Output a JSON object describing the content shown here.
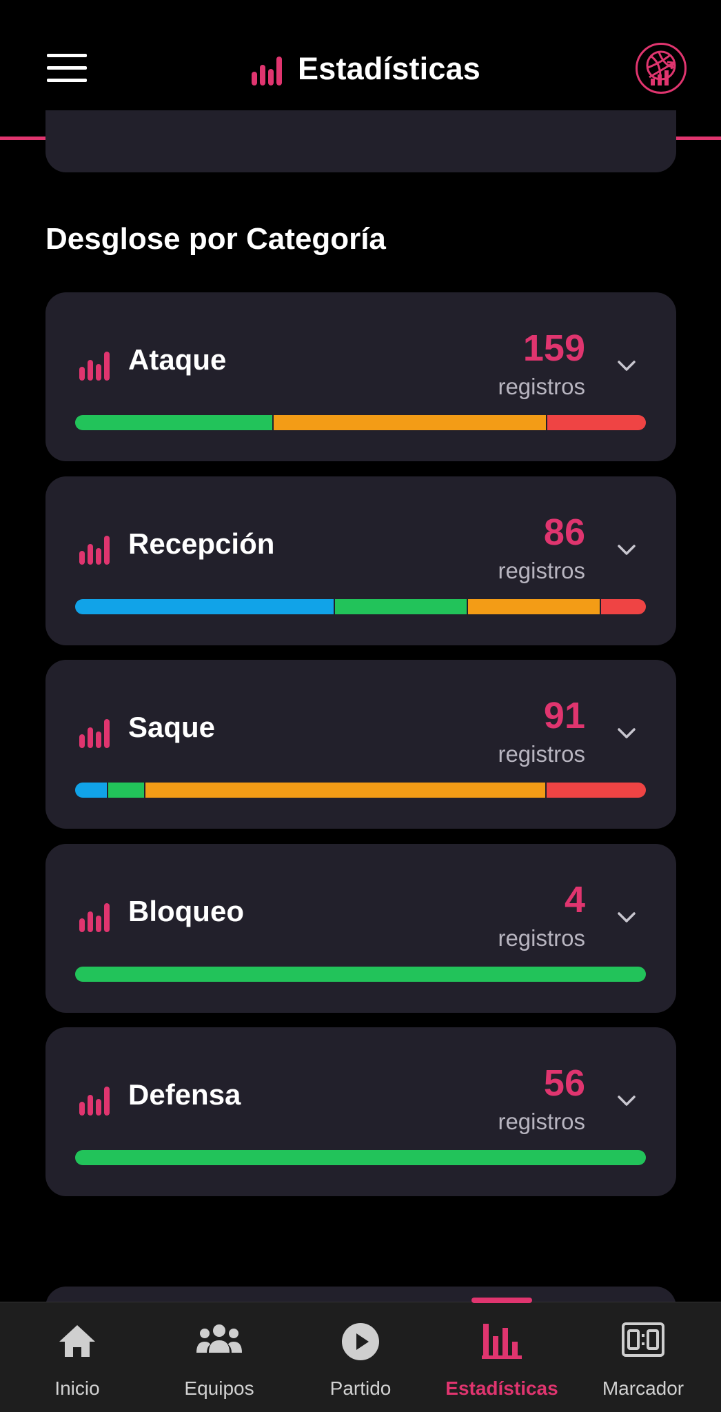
{
  "header": {
    "title": "Estadísticas"
  },
  "section": {
    "title": "Desglose por Categoría"
  },
  "colors": {
    "accent": "#e0356f",
    "blue": "#11a3e8",
    "green": "#22c35a",
    "orange": "#f39c16",
    "red": "#ef4444"
  },
  "categories": [
    {
      "name": "Ataque",
      "count": "159",
      "unit": "registros",
      "distribution": [
        {
          "color": "green",
          "fraction": 0.345
        },
        {
          "color": "orange",
          "fraction": 0.48
        },
        {
          "color": "red",
          "fraction": 0.175
        }
      ]
    },
    {
      "name": "Recepción",
      "count": "86",
      "unit": "registros",
      "distribution": [
        {
          "color": "blue",
          "fraction": 0.453
        },
        {
          "color": "green",
          "fraction": 0.233
        },
        {
          "color": "orange",
          "fraction": 0.233
        },
        {
          "color": "red",
          "fraction": 0.081
        }
      ]
    },
    {
      "name": "Saque",
      "count": "91",
      "unit": "registros",
      "distribution": [
        {
          "color": "blue",
          "fraction": 0.055
        },
        {
          "color": "green",
          "fraction": 0.066
        },
        {
          "color": "orange",
          "fraction": 0.703
        },
        {
          "color": "red",
          "fraction": 0.176
        }
      ]
    },
    {
      "name": "Bloqueo",
      "count": "4",
      "unit": "registros",
      "distribution": [
        {
          "color": "green",
          "fraction": 1.0
        }
      ]
    },
    {
      "name": "Defensa",
      "count": "56",
      "unit": "registros",
      "distribution": [
        {
          "color": "green",
          "fraction": 1.0
        }
      ]
    }
  ],
  "nav": {
    "items": [
      {
        "label": "Inicio",
        "icon": "home-icon"
      },
      {
        "label": "Equipos",
        "icon": "people-icon"
      },
      {
        "label": "Partido",
        "icon": "play-icon"
      },
      {
        "label": "Estadísticas",
        "icon": "bar-chart-icon",
        "active": true
      },
      {
        "label": "Marcador",
        "icon": "scoreboard-icon"
      }
    ]
  }
}
